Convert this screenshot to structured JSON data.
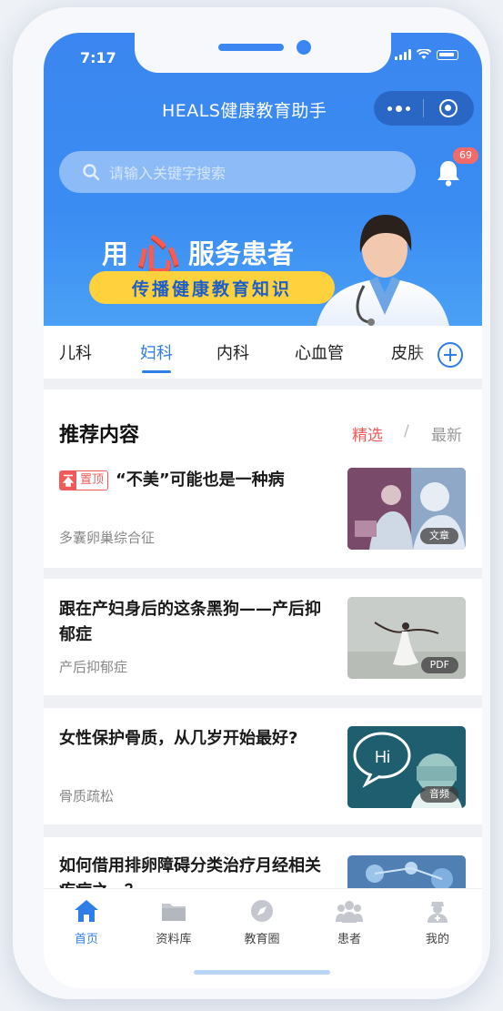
{
  "status_bar": {
    "time": "7:17"
  },
  "header": {
    "title": "HEALS健康教育助手"
  },
  "search": {
    "placeholder": "请输入关键字搜索"
  },
  "notifications": {
    "count": "69"
  },
  "banner": {
    "slogan_prefix": "用",
    "slogan_heart": "心",
    "slogan_suffix": "服务患者",
    "subtitle": "传播健康教育知识"
  },
  "tabs": [
    {
      "label": "儿科"
    },
    {
      "label": "妇科"
    },
    {
      "label": "内科"
    },
    {
      "label": "心血管"
    },
    {
      "label": "皮肤"
    }
  ],
  "active_tab": "妇科",
  "recommend": {
    "title": "推荐内容",
    "filter_selected": "精选",
    "filter_separator": "/",
    "filter_latest": "最新"
  },
  "pin_label": "置顶",
  "items": [
    {
      "title": "“不美”可能也是一种病",
      "tag": "多囊卵巢综合征",
      "type": "文章",
      "pinned": true
    },
    {
      "title": "跟在产妇身后的这条黑狗——产后抑郁症",
      "tag": "产后抑郁症",
      "type": "PDF"
    },
    {
      "title": "女性保护骨质，从几岁开始最好?",
      "tag": "骨质疏松",
      "type": "音频"
    },
    {
      "title": "如何借用排卵障碍分类治疗月经相关疾病之一？",
      "tag": "",
      "type": ""
    }
  ],
  "bottom_nav": [
    {
      "label": "首页",
      "icon": "home-icon",
      "active": true
    },
    {
      "label": "资料库",
      "icon": "folder-icon"
    },
    {
      "label": "教育圈",
      "icon": "compass-icon"
    },
    {
      "label": "患者",
      "icon": "patients-icon"
    },
    {
      "label": "我的",
      "icon": "doctor-profile-icon"
    }
  ],
  "colors": {
    "primary": "#2f7ee8",
    "header_bg": "#3b86f0",
    "accent_red": "#f05a5a",
    "banner_yellow": "#ffd23d"
  }
}
